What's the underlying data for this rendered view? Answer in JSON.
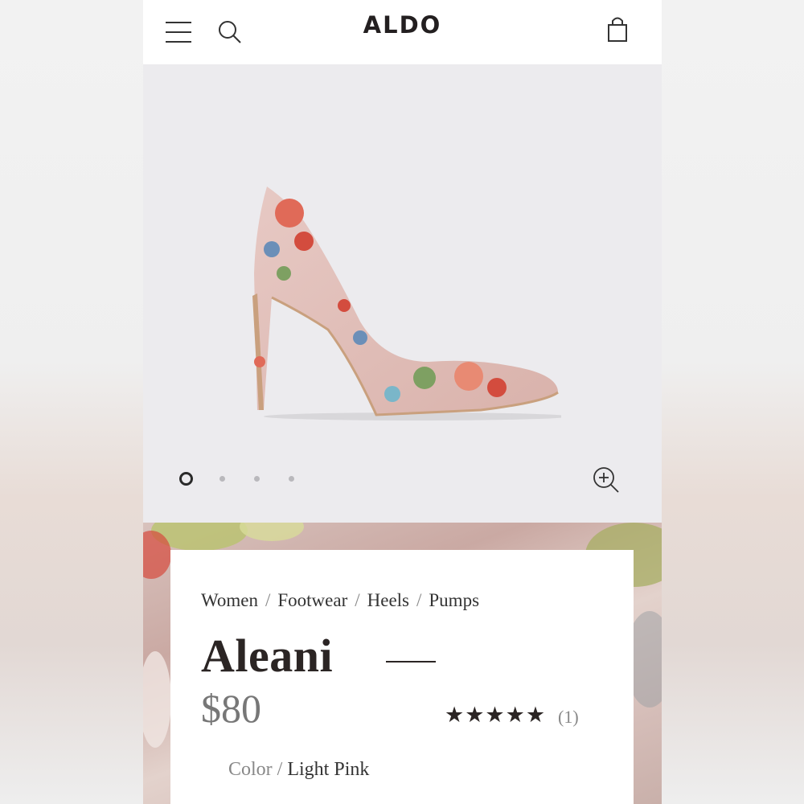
{
  "header": {
    "logo": "ALDO",
    "menu_icon": "hamburger-menu-icon",
    "search_icon": "search-icon",
    "bag_icon": "shopping-bag-icon"
  },
  "gallery": {
    "image_count": 4,
    "active_index": 0,
    "zoom_icon": "zoom-in-icon"
  },
  "product": {
    "breadcrumb": [
      "Women",
      "Footwear",
      "Heels",
      "Pumps"
    ],
    "breadcrumb_separator": "/",
    "name": "Aleani",
    "price": "$80",
    "rating_stars": "★★★★★",
    "rating_value": 5,
    "review_count": "(1)",
    "color_label": "Color",
    "color_separator": "/",
    "color_value": "Light Pink"
  },
  "colors": {
    "gallery_bg": "#ecebee",
    "text_dark": "#2b2524",
    "text_muted": "#777777"
  }
}
